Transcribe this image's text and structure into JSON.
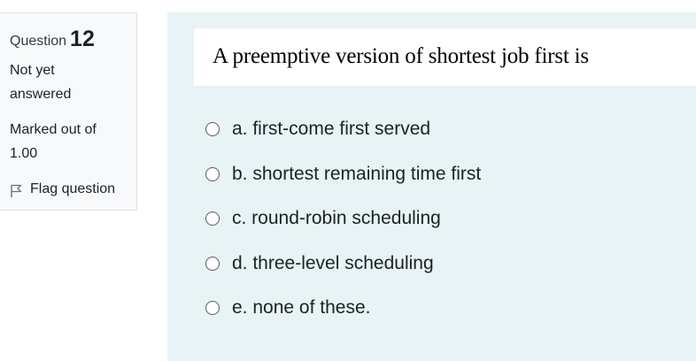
{
  "info": {
    "question_label": "Question",
    "question_number": "12",
    "state_line1": "Not yet",
    "state_line2": "answered",
    "grade_line1": "Marked out of",
    "grade_line2": "1.00",
    "flag_label": "Flag question",
    "flag_icon": "flag-icon"
  },
  "question": {
    "text": "A preemptive version of shortest job first is"
  },
  "answers": [
    {
      "label": "a. first-come first served"
    },
    {
      "label": "b. shortest remaining time first"
    },
    {
      "label": "c. round-robin scheduling"
    },
    {
      "label": "d. three-level scheduling"
    },
    {
      "label": "e. none of these."
    }
  ],
  "colors": {
    "content_background": "#e7f3f5",
    "info_background": "#f8f9fa"
  }
}
